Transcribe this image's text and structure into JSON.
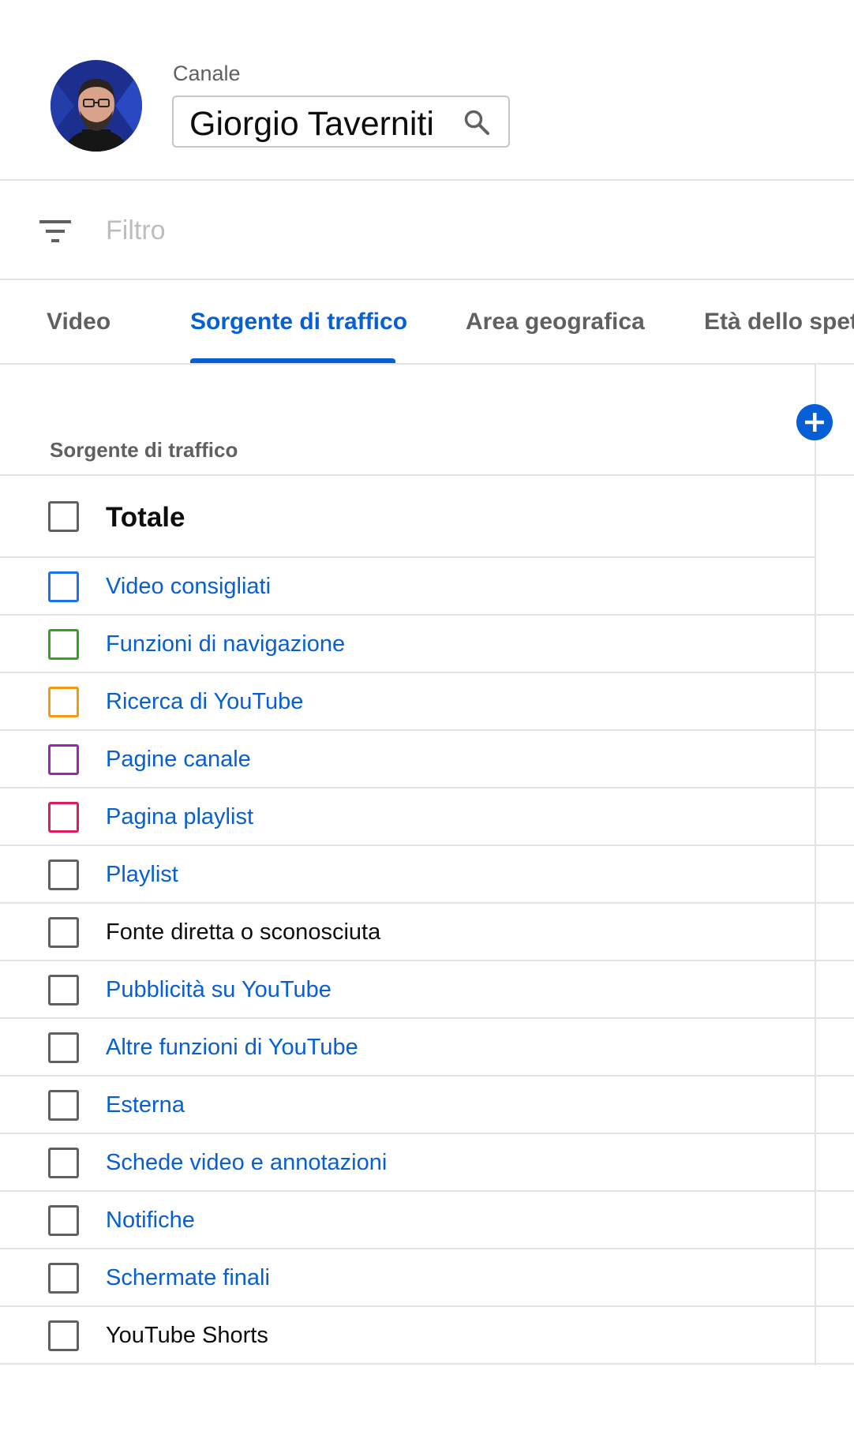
{
  "header": {
    "channel_label": "Canale",
    "channel_name": "Giorgio Taverniti",
    "avatar_alt": "Giorgio Taverniti",
    "search_icon": "search-icon"
  },
  "filter": {
    "placeholder": "Filtro",
    "icon": "filter-icon"
  },
  "tabs": [
    {
      "label": "Video",
      "active": false
    },
    {
      "label": "Sorgente di traffico",
      "active": true
    },
    {
      "label": "Area geografica",
      "active": false
    },
    {
      "label": "Età dello spett",
      "active": false
    }
  ],
  "table": {
    "column_header": "Sorgente di traffico",
    "add_icon": "add-circle-icon",
    "total_label": "Totale",
    "rows": [
      {
        "label": "Video consigliati",
        "color": "#1a73e8",
        "link": true
      },
      {
        "label": "Funzioni di navigazione",
        "color": "#34a324",
        "link": true
      },
      {
        "label": "Ricerca di YouTube",
        "color": "#f29a11",
        "link": true
      },
      {
        "label": "Pagine canale",
        "color": "#9c27b0",
        "link": true
      },
      {
        "label": "Pagina playlist",
        "color": "#e01b5a",
        "link": true
      },
      {
        "label": "Playlist",
        "color": "#606060",
        "link": true
      },
      {
        "label": "Fonte diretta o sconosciuta",
        "color": "#606060",
        "link": false
      },
      {
        "label": "Pubblicità su YouTube",
        "color": "#606060",
        "link": true
      },
      {
        "label": "Altre funzioni di YouTube",
        "color": "#606060",
        "link": true
      },
      {
        "label": "Esterna",
        "color": "#606060",
        "link": true
      },
      {
        "label": "Schede video e annotazioni",
        "color": "#606060",
        "link": true
      },
      {
        "label": "Notifiche",
        "color": "#606060",
        "link": true
      },
      {
        "label": "Schermate finali",
        "color": "#606060",
        "link": true
      },
      {
        "label": "YouTube Shorts",
        "color": "#606060",
        "link": false
      }
    ]
  },
  "colors": {
    "accent": "#065fd4",
    "divider": "#e3e3e3",
    "muted_text": "#606060"
  }
}
